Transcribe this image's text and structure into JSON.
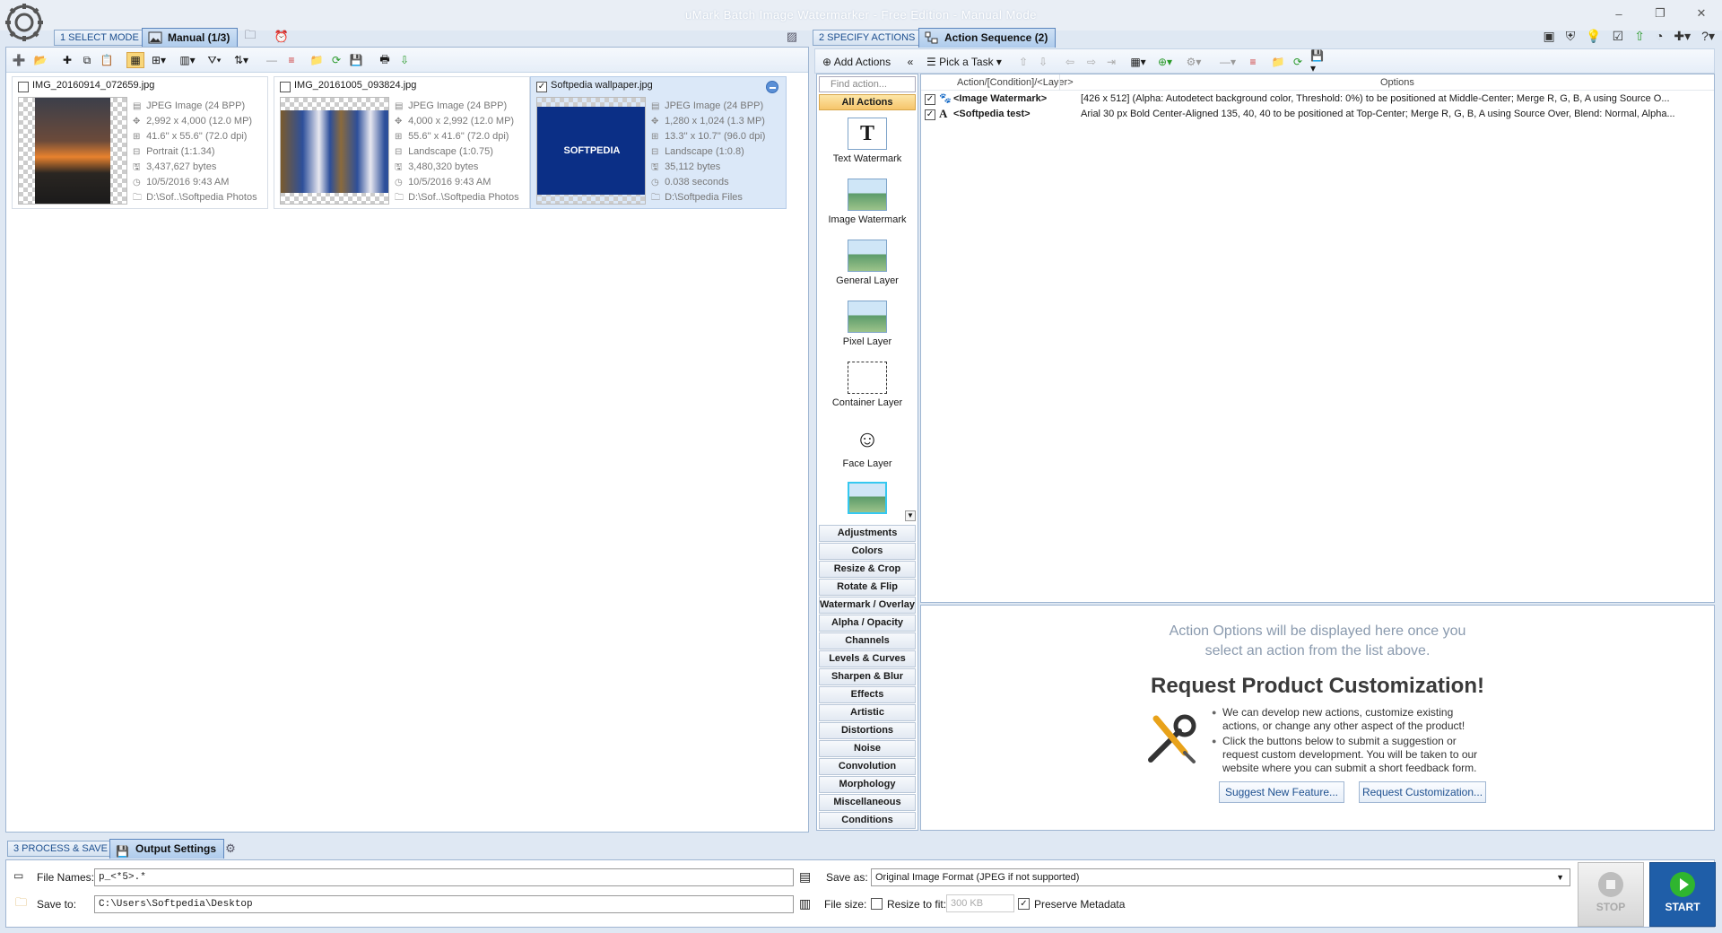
{
  "window": {
    "title": "uMark Batch Image Watermarker - Free Edition - Manual Mode",
    "controls": [
      "–",
      "❐",
      "✕"
    ]
  },
  "step1": {
    "label": "1 SELECT MODE",
    "tab": "Manual (1/3)"
  },
  "step2": {
    "label": "2 SPECIFY ACTIONS",
    "tab": "Action Sequence (2)",
    "add_actions": "Add Actions",
    "pick_task": "Pick a Task"
  },
  "step3": {
    "label": "3 PROCESS & SAVE",
    "tab": "Output Settings"
  },
  "images": [
    {
      "name": "IMG_20160914_072659.jpg",
      "checked": false,
      "type": "JPEG Image (24 BPP)",
      "dims": "2,992 x 4,000 (12.0 MP)",
      "size": "41.6'' x 55.6'' (72.0 dpi)",
      "orientation": "Portrait (1:1.34)",
      "bytes": "3,437,627 bytes",
      "date": "10/5/2016 9:43 AM",
      "path": "D:\\Sof..\\Softpedia Photos"
    },
    {
      "name": "IMG_20161005_093824.jpg",
      "checked": false,
      "type": "JPEG Image (24 BPP)",
      "dims": "4,000 x 2,992 (12.0 MP)",
      "size": "55.6'' x 41.6'' (72.0 dpi)",
      "orientation": "Landscape (1:0.75)",
      "bytes": "3,480,320 bytes",
      "date": "10/5/2016 9:43 AM",
      "path": "D:\\Sof..\\Softpedia Photos"
    },
    {
      "name": "Softpedia wallpaper.jpg",
      "checked": true,
      "type": "JPEG Image (24 BPP)",
      "dims": "1,280 x 1,024 (1.3 MP)",
      "size": "13.3'' x 10.7'' (96.0 dpi)",
      "orientation": "Landscape (1:0.8)",
      "bytes": "35,112 bytes",
      "date": "0.038 seconds",
      "path": "D:\\Softpedia Files",
      "thumb_text": "SOFTPEDIA"
    }
  ],
  "library": {
    "search_placeholder": "Find action...",
    "all_actions": "All Actions",
    "items": [
      "Text Watermark",
      "Image Watermark",
      "General Layer",
      "Pixel Layer",
      "Container Layer",
      "Face Layer"
    ],
    "categories": [
      "Adjustments",
      "Colors",
      "Resize & Crop",
      "Rotate & Flip",
      "Watermark / Overlay",
      "Alpha / Opacity",
      "Channels",
      "Levels & Curves",
      "Sharpen & Blur",
      "Effects",
      "Artistic",
      "Distortions",
      "Noise",
      "Convolution",
      "Morphology",
      "Miscellaneous",
      "Conditions"
    ]
  },
  "action_list": {
    "col_action": "Action/[Condition]/<Layer>",
    "col_options": "Options",
    "rows": [
      {
        "name": "<Image Watermark>",
        "options": "[426 x 512] (Alpha: Autodetect background color, Threshold: 0%) to be positioned at Middle-Center; Merge R, G, B, A using Source O..."
      },
      {
        "name": "<Softpedia test>",
        "options": "Arial 30 px Bold Center-Aligned 135, 40, 40 to be positioned at Top-Center; Merge R, G, B, A using Source Over, Blend: Normal, Alpha..."
      }
    ]
  },
  "options_panel": {
    "hint_line1": "Action Options will be displayed here once you",
    "hint_line2": "select an action from the list above.",
    "title": "Request Product Customization!",
    "bullet1": "We can develop new actions, customize existing actions, or change any other aspect of the product!",
    "bullet2": "Click the buttons below to submit a suggestion or request custom development. You will be taken to our website where you can submit a short feedback form.",
    "btn_suggest": "Suggest New Feature...",
    "btn_request": "Request Customization..."
  },
  "output": {
    "file_names_label": "File Names:",
    "file_names_value": "p_<*5>.*",
    "save_to_label": "Save to:",
    "save_to_value": "C:\\Users\\Softpedia\\Desktop",
    "save_as_label": "Save as:",
    "save_as_value": "Original Image Format (JPEG if not supported)",
    "file_size_label": "File size:",
    "resize_label": "Resize to fit:",
    "resize_value": "300 KB",
    "preserve_label": "Preserve Metadata",
    "stop": "STOP",
    "start": "START"
  },
  "colors": {
    "accent": "#5d86bd",
    "start": "#1f5ea8"
  }
}
